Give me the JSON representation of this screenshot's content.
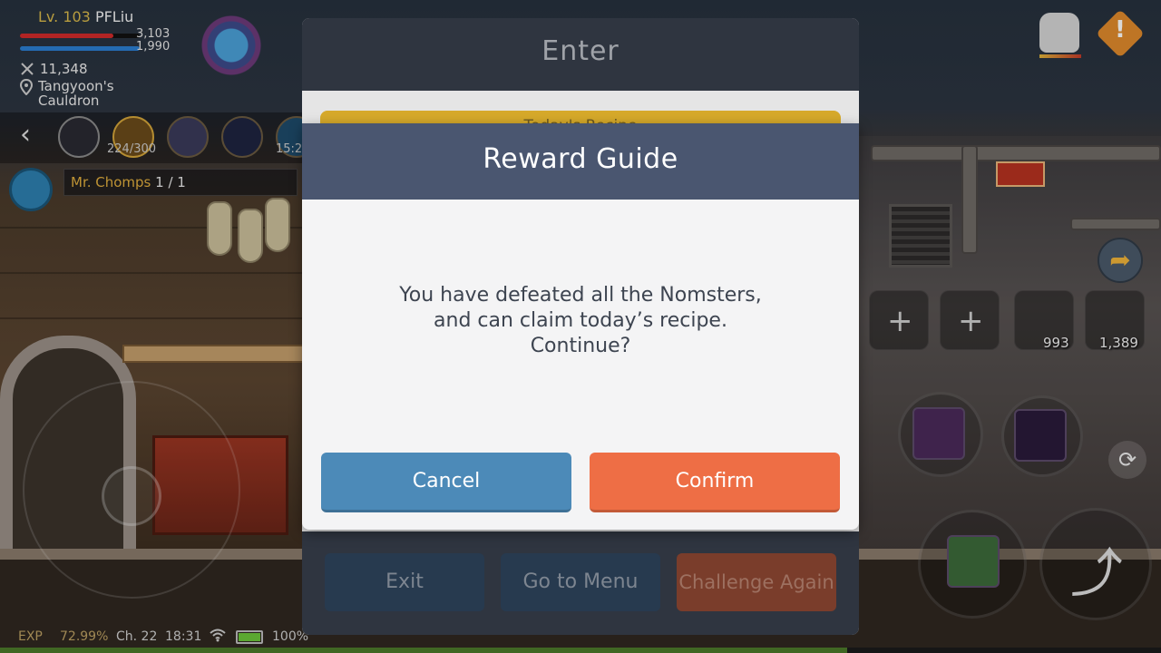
{
  "hud": {
    "level_label": "Lv. 103",
    "player_name": "PFLiu",
    "hp_value": "3,103",
    "mp_value": "1,990",
    "hp_fraction": 0.78,
    "mp_fraction": 1.0,
    "combat_power": "11,348",
    "map_name_line1": "Tangyoon's",
    "map_name_line2": "Cauldron"
  },
  "buffs": {
    "count_label": "224/300",
    "timer_label": "15:2"
  },
  "quest": {
    "name": "Mr. Chomps",
    "progress": "1 / 1"
  },
  "items": {
    "potion_red_count": "993",
    "potion_purple_count": "1,389"
  },
  "status": {
    "exp_label": "EXP",
    "exp_percent": "72.99%",
    "channel": "Ch. 22",
    "clock": "18:31",
    "battery": "100%",
    "exp_fraction": 0.7299
  },
  "background_dialog": {
    "title": "Enter",
    "recipe_strip": "Today's Recipe",
    "buttons": {
      "exit": "Exit",
      "menu": "Go to Menu",
      "again": "Challenge Again"
    }
  },
  "modal": {
    "title": "Reward Guide",
    "message_line1": "You have defeated all the Nomsters,",
    "message_line2": "and can claim today’s recipe.",
    "message_line3": "Continue?",
    "cancel_label": "Cancel",
    "confirm_label": "Confirm"
  },
  "colors": {
    "modal_header": "#4a5670",
    "cancel_button": "#4c8ab8",
    "confirm_button": "#ee6e45",
    "bg_dialog_header": "#2f3540"
  },
  "icons": {
    "back": "chevron-left-icon",
    "alarm": "alarm-clock-icon",
    "location": "location-pin-icon",
    "power": "crossed-swords-icon",
    "bag": "bag-icon",
    "alert": "alert-diamond-icon",
    "swap": "swap-icon",
    "share": "share-arrow-icon"
  }
}
